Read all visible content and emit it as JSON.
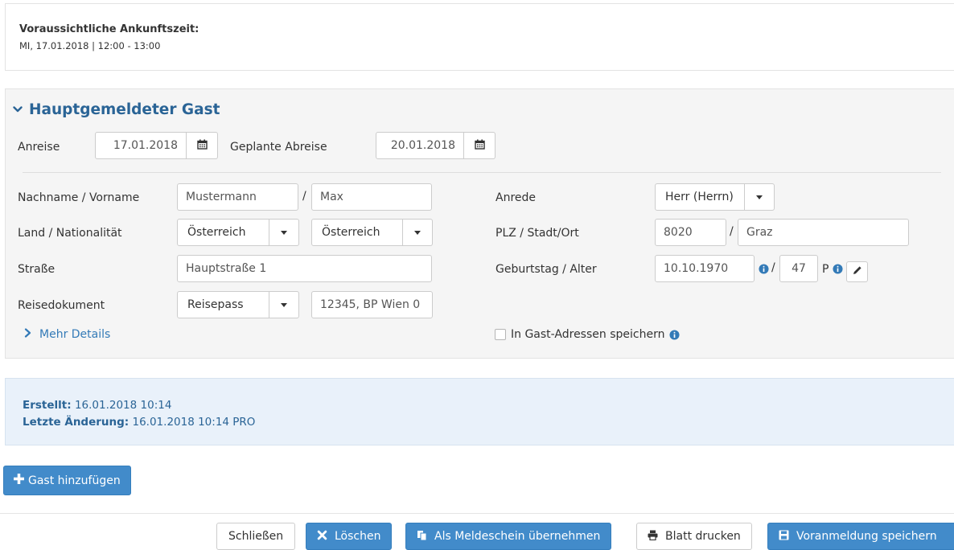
{
  "arrival": {
    "label": "Voraussichtliche Ankunftszeit:",
    "value": "MI, 17.01.2018 | 12:00 - 13:00"
  },
  "guest": {
    "title": "Hauptgemeldeter Gast",
    "anreise_label": "Anreise",
    "anreise_value": "17.01.2018",
    "abreise_label": "Geplante Abreise",
    "abreise_value": "20.01.2018",
    "name_label": "Nachname / Vorname",
    "nachname": "Mustermann",
    "vorname": "Max",
    "land_label": "Land / Nationalität",
    "land": "Österreich",
    "nationalitaet": "Österreich",
    "strasse_label": "Straße",
    "strasse": "Hauptstraße 1",
    "dokument_label": "Reisedokument",
    "dokument": "Reisepass",
    "dokument_nr": "12345, BP Wien 0",
    "anrede_label": "Anrede",
    "anrede": "Herr (Herrn)",
    "plz_label": "PLZ / Stadt/Ort",
    "plz": "8020",
    "ort": "Graz",
    "geburtstag_label": "Geburtstag / Alter",
    "geburtstag": "10.10.1970",
    "alter": "47",
    "alter_suffix": "P",
    "slash": "/",
    "mehr_details": "Mehr Details",
    "save_address_label": "In Gast-Adressen speichern"
  },
  "meta": {
    "erstellt_label": "Erstellt:",
    "erstellt_value": "16.01.2018 10:14",
    "aenderung_label": "Letzte Änderung:",
    "aenderung_value": "16.01.2018 10:14 PRO"
  },
  "buttons": {
    "add_guest": "Gast hinzufügen",
    "close": "Schließen",
    "delete": "Löschen",
    "take_over": "Als Meldeschein übernehmen",
    "print": "Blatt drucken",
    "save": "Voranmeldung speichern"
  },
  "colors": {
    "primary": "#428bca",
    "link": "#337ab7",
    "title": "#2a6496",
    "meta_bg": "#e9f1fa"
  },
  "icons": [
    "calendar-icon",
    "chevron-down-icon",
    "chevron-right-icon",
    "info-icon",
    "pencil-icon",
    "plus-icon",
    "times-icon",
    "copy-icon",
    "print-icon",
    "floppy-icon"
  ]
}
